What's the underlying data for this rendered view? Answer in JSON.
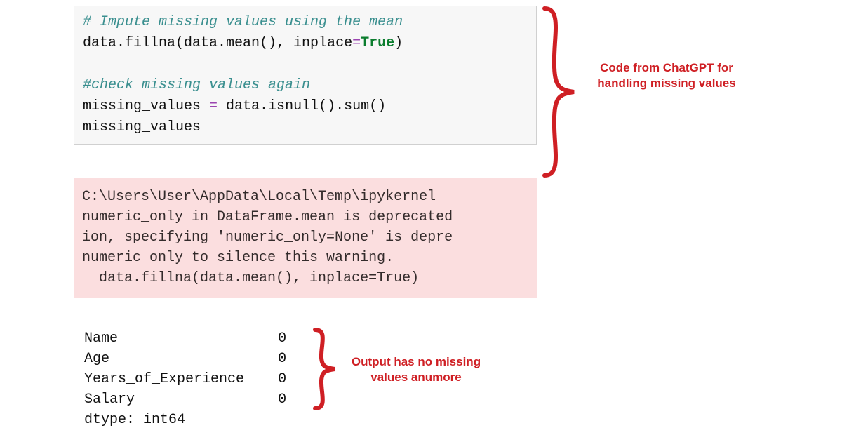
{
  "code": {
    "comment1": "# Impute missing values using the mean",
    "line2_a": "data.fillna(d",
    "line2_b": "ata.mean(), inplace",
    "line2_c": "=",
    "line2_d": "True",
    "line2_e": ")",
    "blank": "",
    "comment2": "#check missing values again",
    "line4_a": "missing_values ",
    "line4_b": "=",
    "line4_c": " data.isnull().sum()",
    "line5": "missing_values"
  },
  "warning": {
    "l1": "C:\\Users\\User\\AppData\\Local\\Temp\\ipykernel_",
    "l2": "numeric_only in DataFrame.mean is deprecated",
    "l3": "ion, specifying 'numeric_only=None' is depre",
    "l4": "numeric_only to silence this warning.",
    "l5": "  data.fillna(data.mean(), inplace=True)"
  },
  "output": {
    "r1k": "Name",
    "r1v": "0",
    "r2k": "Age",
    "r2v": "0",
    "r3k": "Years_of_Experience",
    "r3v": "0",
    "r4k": "Salary",
    "r4v": "0",
    "dtype": "dtype: int64"
  },
  "annotations": {
    "top": "Code from ChatGPT for handling missing values",
    "bottom": "Output has no missing values anumore"
  },
  "colors": {
    "accent": "#cf1f24"
  }
}
